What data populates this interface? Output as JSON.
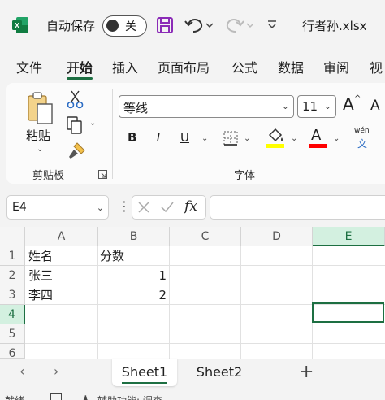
{
  "titlebar": {
    "autosave_label": "自动保存",
    "autosave_state": "关",
    "filename": "行者孙.xlsx"
  },
  "tabs": [
    "文件",
    "开始",
    "插入",
    "页面布局",
    "公式",
    "数据",
    "审阅",
    "视"
  ],
  "active_tab": "开始",
  "ribbon": {
    "paste_label": "粘贴",
    "clipboard_group": "剪贴板",
    "font_group": "字体",
    "font_name": "等线",
    "font_size": "11",
    "bold": "B",
    "italic": "I",
    "underline": "U",
    "font_color_letter": "A",
    "wen_top": "wén",
    "wen_bottom": "文",
    "grow_font": "A",
    "shrink_font": "A"
  },
  "formula_bar": {
    "name_box": "E4",
    "fx": "fx",
    "formula": ""
  },
  "grid": {
    "columns": [
      "A",
      "B",
      "C",
      "D",
      "E"
    ],
    "selected_column": "E",
    "rows": [
      "1",
      "2",
      "3",
      "4",
      "5",
      "6"
    ],
    "selected_row": "4",
    "cells": {
      "A1": "姓名",
      "B1": "分数",
      "A2": "张三",
      "B2": "1",
      "A3": "李四",
      "B3": "2"
    }
  },
  "sheets": [
    "Sheet1",
    "Sheet2"
  ],
  "active_sheet": "Sheet1",
  "add_sheet": "+",
  "status": {
    "ready": "就绪",
    "accessibility": "辅助功能: 调查"
  },
  "colors": {
    "accent": "#1d6f42",
    "excel_green": "#107c41",
    "save_purple": "#8b2bb7",
    "highlight_yellow": "#ffff00",
    "font_red": "#ff0000"
  }
}
